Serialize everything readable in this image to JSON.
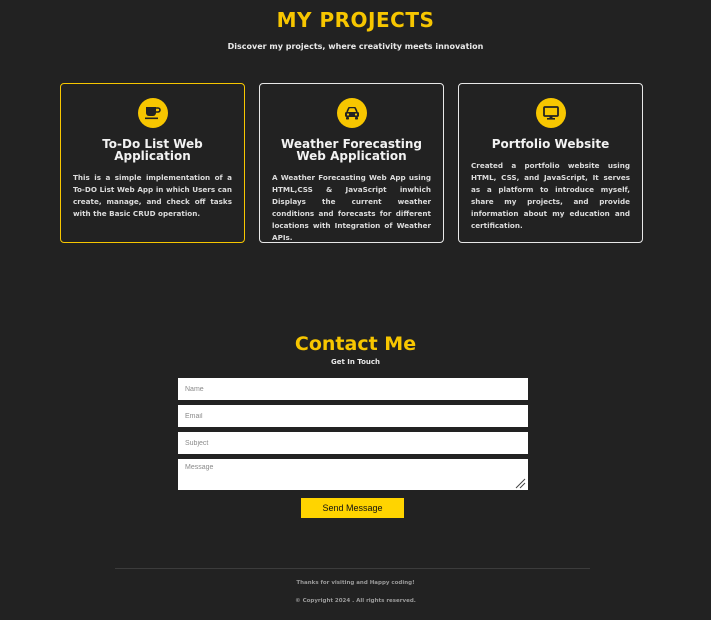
{
  "projects": {
    "title": "MY PROJECTS",
    "subtitle": "Discover my projects, where creativity meets innovation",
    "cards": [
      {
        "icon": "coffee-icon",
        "title_line1": "To-Do List Web",
        "title_line2": "Application",
        "description": "This is a simple implementation of a To-DO List Web App in which Users can create, manage, and check off tasks with the Basic CRUD operation."
      },
      {
        "icon": "car-icon",
        "title_line1": "Weather Forecasting",
        "title_line2": "Web Application",
        "description": "A Weather Forecasting Web App using HTML,CSS & JavaScript inwhich Displays the current weather conditions and forecasts for different locations with Integration of Weather APIs."
      },
      {
        "icon": "desktop-icon",
        "title_line1": "Portfolio Website",
        "description": "Created a portfolio website using HTML, CSS, and JavaScript, It serves as a platform to introduce myself, share my projects, and provide information about my education and certification."
      }
    ]
  },
  "contact": {
    "title": "Contact Me",
    "subtitle": "Get In Touch",
    "name_placeholder": "Name",
    "email_placeholder": "Email",
    "subject_placeholder": "Subject",
    "message_placeholder": "Message",
    "send_label": "Send Message"
  },
  "footer": {
    "thanks": "Thanks for visiting and Happy coding!",
    "copyright": "© Copyright 2024 . All rights reserved."
  },
  "colors": {
    "accent": "#f7c600",
    "background": "#222222"
  }
}
